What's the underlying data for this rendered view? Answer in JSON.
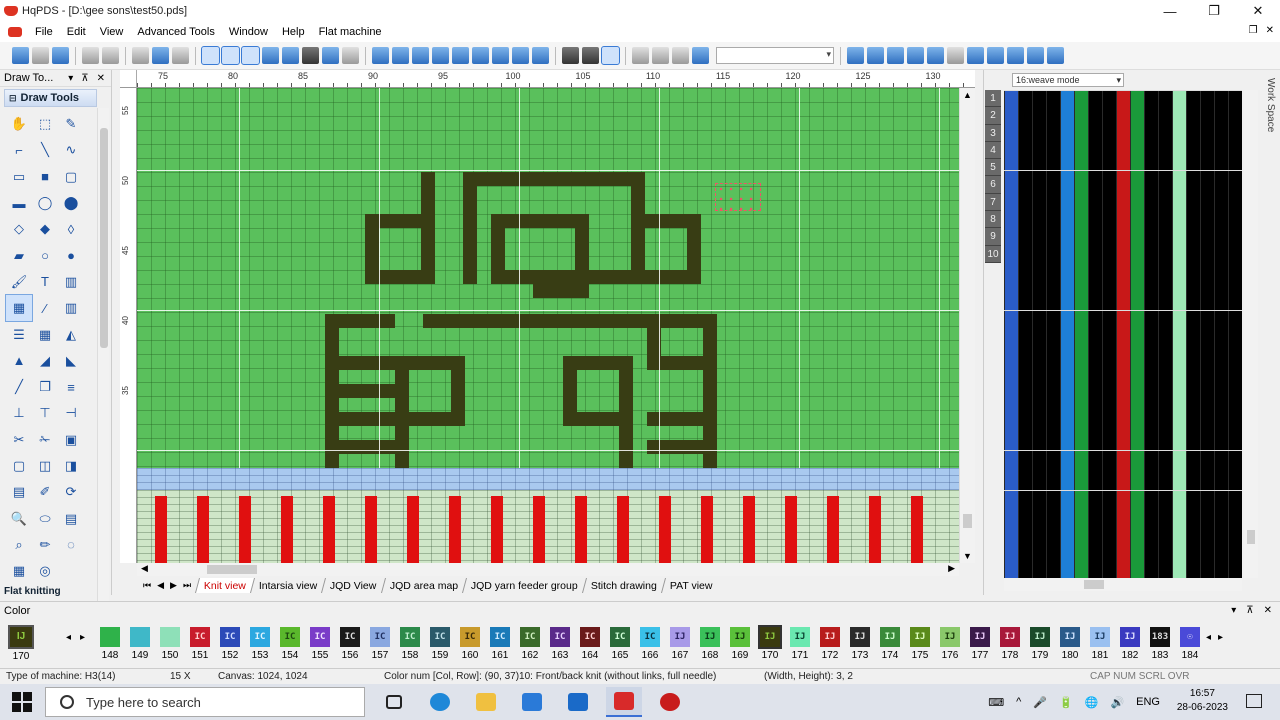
{
  "window": {
    "title": "HqPDS - [D:\\gee sons\\test50.pds]",
    "controls": [
      "—",
      "❐",
      "✕"
    ]
  },
  "menu": {
    "items": [
      "File",
      "Edit",
      "View",
      "Advanced Tools",
      "Window",
      "Help",
      "Flat machine"
    ],
    "mdi_controls": [
      "❐",
      "✕"
    ]
  },
  "left_panel": {
    "header": "Draw To...",
    "header_controls": [
      "▾",
      "⊼",
      "✕"
    ],
    "group_title": "Draw Tools",
    "group2_title": "Flat knitting",
    "tool_icons": [
      "hand-icon",
      "select-rect-icon",
      "pencil-icon",
      "polyline-icon",
      "line-icon",
      "curve-icon",
      "rect-outline-icon",
      "rect-fill-icon",
      "round-rect-icon",
      "round-rect-fill-icon",
      "ellipse-icon",
      "ellipse-fill-icon",
      "diamond-icon",
      "diamond-fill-icon",
      "diamond-outline-icon",
      "eraser-icon",
      "circle-outline-icon",
      "circle-fill-icon",
      "brush-icon",
      "text-icon",
      "barcode-icon",
      "grid-tool-icon",
      "dropper-icon",
      "columns-icon",
      "rows-icon",
      "blocks-icon",
      "tag-icon",
      "fill-icon",
      "fill2-icon",
      "fill3-icon",
      "wand-icon",
      "copy-icon",
      "align-icon",
      "align-left-icon",
      "align-center-icon",
      "align-right-icon",
      "cut-icon",
      "scissors-icon",
      "box-icon",
      "frame-icon",
      "frame2-icon",
      "frame3-icon",
      "image-icon",
      "pen-icon",
      "rotate-icon",
      "zoom-icon",
      "shape-icon",
      "layers-icon",
      "measure-icon",
      "eraser2-icon",
      "lasso-icon",
      "grid2-icon",
      "circle-icon"
    ],
    "tool_glyphs": [
      "✋",
      "⬚",
      "✎",
      "⌐",
      "╲",
      "∿",
      "▭",
      "■",
      "▢",
      "▬",
      "◯",
      "⬤",
      "◇",
      "◆",
      "◊",
      "▰",
      "○",
      "●",
      "🖌",
      "T",
      "▥",
      "▦",
      "⁄",
      "▥",
      "☰",
      "▦",
      "◭",
      "▲",
      "◢",
      "◣",
      "╱",
      "❐",
      "≡",
      "⊥",
      "⊤",
      "⊣",
      "✂",
      "✁",
      "▣",
      "▢",
      "◫",
      "◨",
      "▤",
      "✐",
      "⟳",
      "🔍",
      "⬭",
      "▤",
      "⌕",
      "✏",
      "◌",
      "▦",
      "◎"
    ]
  },
  "ruler": {
    "top_ticks": [
      "75",
      "80",
      "85",
      "90",
      "95",
      "100",
      "105",
      "110",
      "115",
      "120",
      "125",
      "130"
    ],
    "left_ticks": [
      "55",
      "50",
      "45",
      "40",
      "35"
    ]
  },
  "canvas": {
    "colors": {
      "background": "#5ac05c",
      "motif": "#383d14",
      "stripe_blue": "#a9c9ef",
      "stripe_red": "#e01010"
    }
  },
  "tabs": {
    "nav": [
      "⏮",
      "◀",
      "▶",
      "⏭"
    ],
    "items": [
      "Knit view",
      "Intarsia view",
      "JQD View",
      "JQD area map",
      "JQD yarn feeder group",
      "Stitch drawing",
      "PAT view"
    ],
    "active_index": 0
  },
  "right_panel": {
    "mode": "16:weave mode",
    "row_numbers": [
      "1",
      "2",
      "3",
      "4",
      "5",
      "6",
      "7",
      "8",
      "9",
      "10"
    ],
    "workspace_label": "Work Space",
    "weave_columns": [
      {
        "color": "#2a5cc8"
      },
      {
        "color": "#000000"
      },
      {
        "color": "#000000"
      },
      {
        "color": "#000000"
      },
      {
        "color": "#1e7fd6"
      },
      {
        "color": "#1a9a3a"
      },
      {
        "color": "#000000"
      },
      {
        "color": "#000000"
      },
      {
        "color": "#c81818"
      },
      {
        "color": "#1a9a3a"
      },
      {
        "color": "#000000"
      },
      {
        "color": "#000000"
      },
      {
        "color": "#9ee8b6"
      },
      {
        "color": "#000000"
      },
      {
        "color": "#000000"
      },
      {
        "color": "#000000"
      }
    ]
  },
  "color_panel": {
    "title": "Color",
    "controls": [
      "▾",
      "⊼",
      "✕"
    ],
    "current": {
      "label": "IJ",
      "number": "170"
    },
    "nav": [
      "◂",
      "▸"
    ],
    "swatches": [
      {
        "num": "148",
        "label": "",
        "bg": "#2fb24a",
        "fg": "#1a6b2a"
      },
      {
        "num": "149",
        "label": "",
        "bg": "#3fb8c8",
        "fg": "#1a6b70"
      },
      {
        "num": "150",
        "label": "",
        "bg": "#8ee0b8",
        "fg": "#3a8a60"
      },
      {
        "num": "151",
        "label": "IC",
        "bg": "#c81c2c",
        "fg": "#ffd0d0"
      },
      {
        "num": "152",
        "label": "IC",
        "bg": "#2c4ab8",
        "fg": "#d0dcff"
      },
      {
        "num": "153",
        "label": "IC",
        "bg": "#2ca8e0",
        "fg": "#e0f4ff"
      },
      {
        "num": "154",
        "label": "IC",
        "bg": "#5ab82c",
        "fg": "#1e4a10"
      },
      {
        "num": "155",
        "label": "IC",
        "bg": "#7a3cc8",
        "fg": "#f0e0ff"
      },
      {
        "num": "156",
        "label": "IC",
        "bg": "#1a1a1a",
        "fg": "#dddddd"
      },
      {
        "num": "157",
        "label": "IC",
        "bg": "#8aa8e0",
        "fg": "#203060"
      },
      {
        "num": "158",
        "label": "IC",
        "bg": "#2c8a4a",
        "fg": "#c0f0d0"
      },
      {
        "num": "159",
        "label": "IC",
        "bg": "#2a5a6a",
        "fg": "#c0e0e8"
      },
      {
        "num": "160",
        "label": "IC",
        "bg": "#c89a2c",
        "fg": "#3a2a08"
      },
      {
        "num": "161",
        "label": "IC",
        "bg": "#1a7ab8",
        "fg": "#d0ecff"
      },
      {
        "num": "162",
        "label": "IC",
        "bg": "#3a6a2a",
        "fg": "#d0f0c0"
      },
      {
        "num": "163",
        "label": "IC",
        "bg": "#5a2a8a",
        "fg": "#e8d0ff"
      },
      {
        "num": "164",
        "label": "IC",
        "bg": "#6a1a1a",
        "fg": "#ffd0d0"
      },
      {
        "num": "165",
        "label": "IC",
        "bg": "#2a6a3a",
        "fg": "#d0ffd8"
      },
      {
        "num": "166",
        "label": "IC",
        "bg": "#3ac0e8",
        "fg": "#0a3040"
      },
      {
        "num": "167",
        "label": "IJ",
        "bg": "#a89ae8",
        "fg": "#2a2060"
      },
      {
        "num": "168",
        "label": "IJ",
        "bg": "#3ac05a",
        "fg": "#0a3a18"
      },
      {
        "num": "169",
        "label": "IJ",
        "bg": "#5ac03a",
        "fg": "#143a0a"
      },
      {
        "num": "170",
        "label": "IJ",
        "bg": "#3a3a10",
        "fg": "#8fcc40",
        "selected": true
      },
      {
        "num": "171",
        "label": "IJ",
        "bg": "#6ae8b0",
        "fg": "#0a4030"
      },
      {
        "num": "172",
        "label": "IJ",
        "bg": "#b81c1c",
        "fg": "#ffd0d0"
      },
      {
        "num": "173",
        "label": "IJ",
        "bg": "#2a2a2a",
        "fg": "#e0e0e0"
      },
      {
        "num": "174",
        "label": "IJ",
        "bg": "#3a8a3a",
        "fg": "#d0ffd0"
      },
      {
        "num": "175",
        "label": "IJ",
        "bg": "#5a8a1a",
        "fg": "#e0ffc0"
      },
      {
        "num": "176",
        "label": "IJ",
        "bg": "#8ac86a",
        "fg": "#1a3a0a"
      },
      {
        "num": "177",
        "label": "IJ",
        "bg": "#3a1a4a",
        "fg": "#f0d0ff"
      },
      {
        "num": "178",
        "label": "IJ",
        "bg": "#a8183a",
        "fg": "#ffd0dc"
      },
      {
        "num": "179",
        "label": "IJ",
        "bg": "#1a4a2a",
        "fg": "#c0f0d0"
      },
      {
        "num": "180",
        "label": "IJ",
        "bg": "#2a5a8a",
        "fg": "#d0e4ff"
      },
      {
        "num": "181",
        "label": "IJ",
        "bg": "#9ac0f0",
        "fg": "#1a3a60"
      },
      {
        "num": "182",
        "label": "IJ",
        "bg": "#3a3ac0",
        "fg": "#e0e0ff"
      },
      {
        "num": "183",
        "label": "183",
        "bg": "#111111",
        "fg": "#dddddd"
      },
      {
        "num": "184",
        "label": "☉",
        "bg": "#4a4ad8",
        "fg": "#ffffff"
      }
    ]
  },
  "status_bar": {
    "machine": "Type of machine: H3(14)",
    "scale": "15 X",
    "canvas": "Canvas: 1024, 1024",
    "color_num": "Color num [Col, Row]: (90, 37)10: Front/back knit (without links, full needle)",
    "size": "(Width, Height): 3, 2",
    "indicators": "CAP  NUM  SCRL  OVR"
  },
  "taskbar": {
    "search_placeholder": "Type here to search",
    "language": "ENG",
    "time": "16:57",
    "date": "28-06-2023",
    "tray_icons": [
      "^",
      "🎤",
      "🔋",
      "🌐",
      "🔊"
    ],
    "apps": [
      {
        "name": "task-view-icon",
        "color": "#222222"
      },
      {
        "name": "edge-icon",
        "color": "#1e88d8"
      },
      {
        "name": "file-explorer-icon",
        "color": "#f0c040"
      },
      {
        "name": "store-icon",
        "color": "#2a7ad8"
      },
      {
        "name": "mail-icon",
        "color": "#1a6ac8"
      },
      {
        "name": "hqpds-icon",
        "color": "#d82a2a"
      },
      {
        "name": "app-icon",
        "color": "#c81c1c"
      }
    ]
  }
}
